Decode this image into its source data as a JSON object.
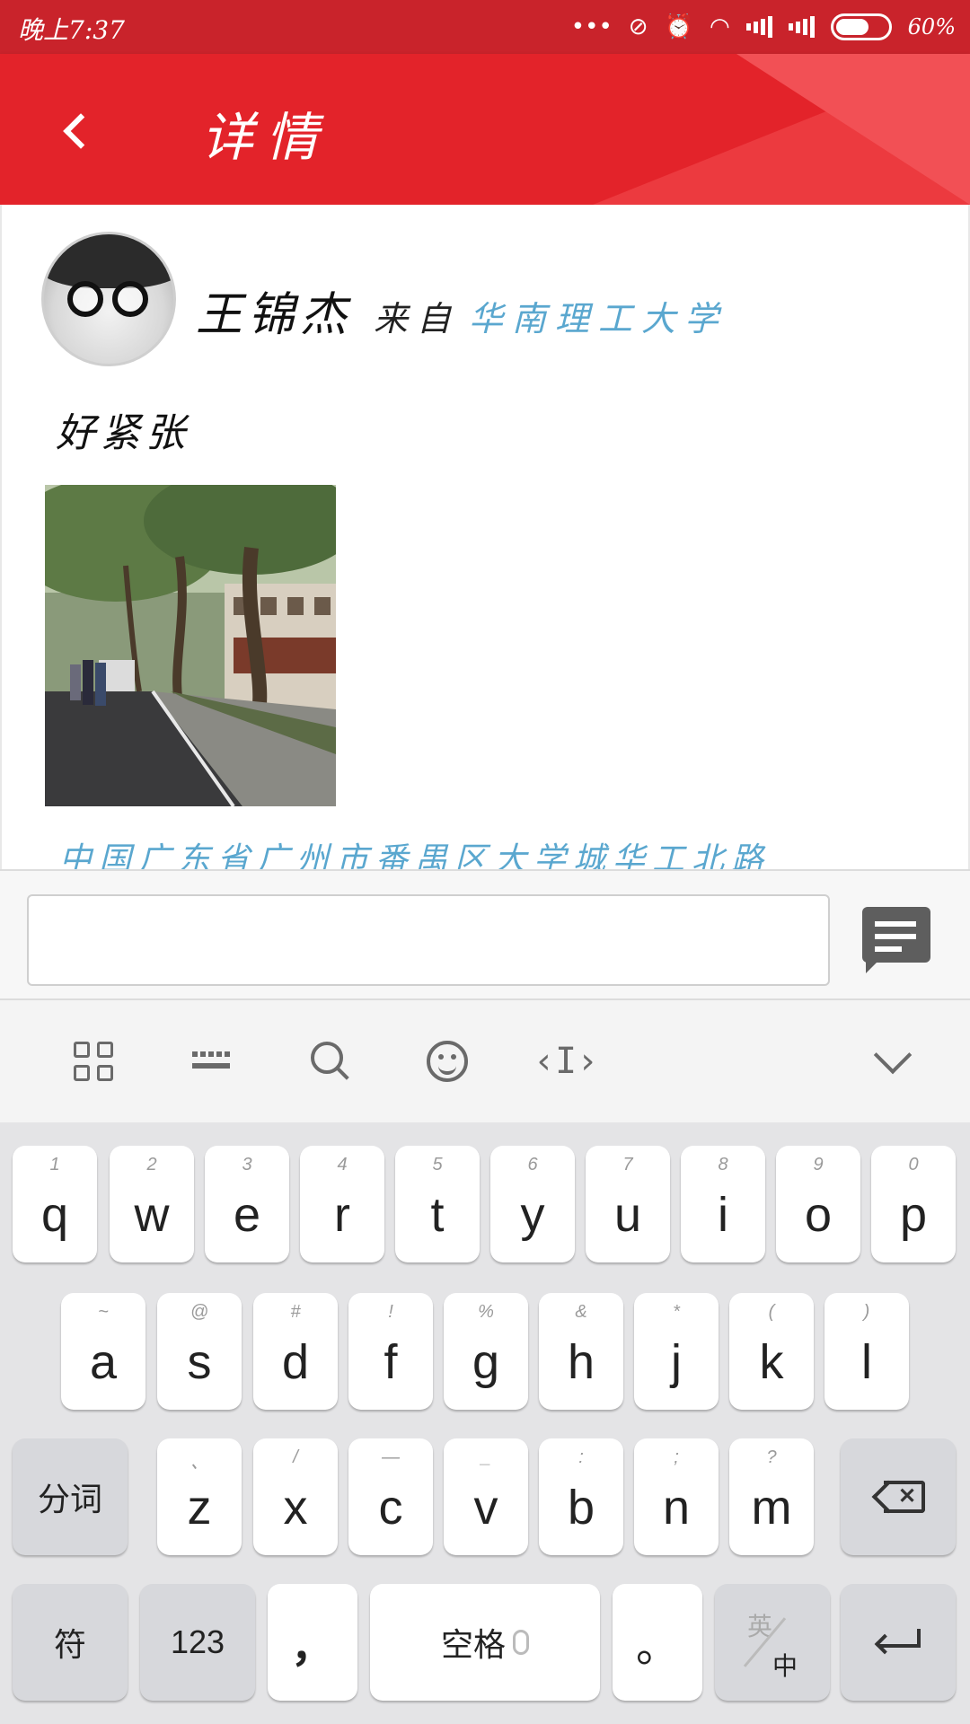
{
  "status_bar": {
    "time": "晚上7:37",
    "battery": "60%",
    "icons": [
      "more-dots-icon",
      "vibrate-icon",
      "alarm-icon",
      "wifi-icon",
      "signal-4g-icon",
      "signal-icon",
      "battery-icon"
    ]
  },
  "header": {
    "title": "详情",
    "back_icon": "back-arrow-icon",
    "color": "#e3232a"
  },
  "post": {
    "author": "王锦杰",
    "from_label": "来自",
    "school": "华南理工大学",
    "text": "好紧张",
    "location": "中国广东省广州市番禺区大学城华工北路",
    "link_color": "#5aa7cf"
  },
  "comment": {
    "value": "",
    "send_icon": "comment-bubble-icon"
  },
  "keyboard_toolbar": {
    "icons": [
      "grid-icon",
      "keyboard-icon",
      "search-icon",
      "emoji-icon",
      "cursor-icon",
      "chevron-down-icon"
    ]
  },
  "keyboard": {
    "row1": [
      {
        "key": "q",
        "hint": "1"
      },
      {
        "key": "w",
        "hint": "2"
      },
      {
        "key": "e",
        "hint": "3"
      },
      {
        "key": "r",
        "hint": "4"
      },
      {
        "key": "t",
        "hint": "5"
      },
      {
        "key": "y",
        "hint": "6"
      },
      {
        "key": "u",
        "hint": "7"
      },
      {
        "key": "i",
        "hint": "8"
      },
      {
        "key": "o",
        "hint": "9"
      },
      {
        "key": "p",
        "hint": "0"
      }
    ],
    "row2": [
      {
        "key": "a",
        "hint": "~"
      },
      {
        "key": "s",
        "hint": "@"
      },
      {
        "key": "d",
        "hint": "#"
      },
      {
        "key": "f",
        "hint": "!"
      },
      {
        "key": "g",
        "hint": "%"
      },
      {
        "key": "h",
        "hint": "&"
      },
      {
        "key": "j",
        "hint": "*"
      },
      {
        "key": "k",
        "hint": "("
      },
      {
        "key": "l",
        "hint": ")"
      }
    ],
    "row3": [
      {
        "key": "z",
        "hint": "、"
      },
      {
        "key": "x",
        "hint": "/"
      },
      {
        "key": "c",
        "hint": "—"
      },
      {
        "key": "v",
        "hint": "_"
      },
      {
        "key": "b",
        "hint": ":"
      },
      {
        "key": "n",
        "hint": ";"
      },
      {
        "key": "m",
        "hint": "?"
      }
    ],
    "segment_label": "分词",
    "symbol_label": "符",
    "num_label": "123",
    "comma_label": "，",
    "space_label": "空格",
    "period_label": "。",
    "lang_top": "英",
    "lang_bottom": "中"
  }
}
